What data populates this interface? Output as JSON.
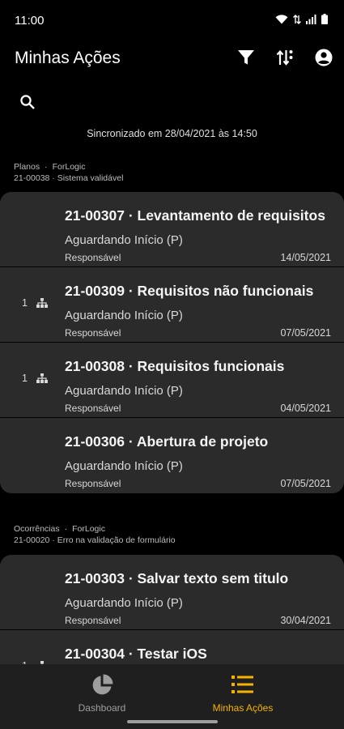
{
  "status_bar": {
    "time": "11:00"
  },
  "appbar": {
    "title": "Minhas Ações"
  },
  "sync": {
    "text": "Sincronizado em 28/04/2021 às 14:50"
  },
  "groups": [
    {
      "type": "Planos",
      "company": "ForLogic",
      "subtitle": "21-00038 · Sistema validável",
      "cards": [
        {
          "title": "21-00307 · Levantamento de requisitos",
          "status": "Aguardando Início (P)",
          "role": "Responsável",
          "date": "14/05/2021",
          "count": ""
        },
        {
          "title": "21-00309 · Requisitos não funcionais",
          "status": "Aguardando Início (P)",
          "role": "Responsável",
          "date": "07/05/2021",
          "count": "1"
        },
        {
          "title": "21-00308 · Requisitos funcionais",
          "status": "Aguardando Início (P)",
          "role": "Responsável",
          "date": "04/05/2021",
          "count": "1"
        },
        {
          "title": "21-00306 · Abertura de projeto",
          "status": "Aguardando Início (P)",
          "role": "Responsável",
          "date": "07/05/2021",
          "count": ""
        }
      ]
    },
    {
      "type": "Ocorrências",
      "company": "ForLogic",
      "subtitle": "21-00020 · Erro na validação de formulário",
      "cards": [
        {
          "title": "21-00303 · Salvar texto sem titulo",
          "status": "Aguardando Início (P)",
          "role": "Responsável",
          "date": "30/04/2021",
          "count": ""
        },
        {
          "title": "21-00304 · Testar iOS",
          "status": "",
          "role": "",
          "date": "",
          "count": "1"
        }
      ]
    }
  ],
  "bottom_nav": {
    "items": [
      {
        "label": "Dashboard",
        "icon": "pie-chart-icon",
        "active": false
      },
      {
        "label": "Minhas Ações",
        "icon": "list-icon",
        "active": true
      }
    ]
  },
  "colors": {
    "background": "#000000",
    "card": "#2b2b2b",
    "accent": "#f5b300",
    "nav": "#1f1f1f"
  }
}
